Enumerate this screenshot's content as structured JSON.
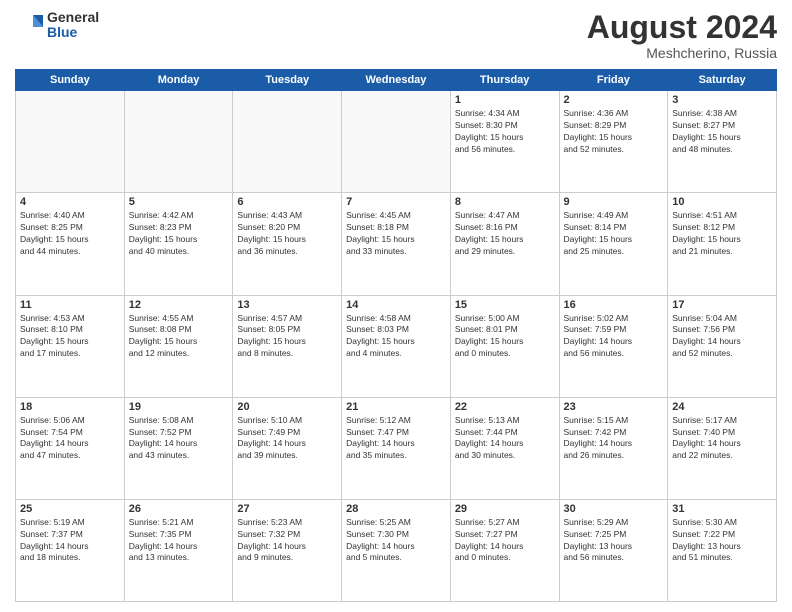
{
  "header": {
    "logo_general": "General",
    "logo_blue": "Blue",
    "month_year": "August 2024",
    "location": "Meshcherino, Russia"
  },
  "days_of_week": [
    "Sunday",
    "Monday",
    "Tuesday",
    "Wednesday",
    "Thursday",
    "Friday",
    "Saturday"
  ],
  "weeks": [
    [
      {
        "day": "",
        "info": ""
      },
      {
        "day": "",
        "info": ""
      },
      {
        "day": "",
        "info": ""
      },
      {
        "day": "",
        "info": ""
      },
      {
        "day": "1",
        "info": "Sunrise: 4:34 AM\nSunset: 8:30 PM\nDaylight: 15 hours\nand 56 minutes."
      },
      {
        "day": "2",
        "info": "Sunrise: 4:36 AM\nSunset: 8:29 PM\nDaylight: 15 hours\nand 52 minutes."
      },
      {
        "day": "3",
        "info": "Sunrise: 4:38 AM\nSunset: 8:27 PM\nDaylight: 15 hours\nand 48 minutes."
      }
    ],
    [
      {
        "day": "4",
        "info": "Sunrise: 4:40 AM\nSunset: 8:25 PM\nDaylight: 15 hours\nand 44 minutes."
      },
      {
        "day": "5",
        "info": "Sunrise: 4:42 AM\nSunset: 8:23 PM\nDaylight: 15 hours\nand 40 minutes."
      },
      {
        "day": "6",
        "info": "Sunrise: 4:43 AM\nSunset: 8:20 PM\nDaylight: 15 hours\nand 36 minutes."
      },
      {
        "day": "7",
        "info": "Sunrise: 4:45 AM\nSunset: 8:18 PM\nDaylight: 15 hours\nand 33 minutes."
      },
      {
        "day": "8",
        "info": "Sunrise: 4:47 AM\nSunset: 8:16 PM\nDaylight: 15 hours\nand 29 minutes."
      },
      {
        "day": "9",
        "info": "Sunrise: 4:49 AM\nSunset: 8:14 PM\nDaylight: 15 hours\nand 25 minutes."
      },
      {
        "day": "10",
        "info": "Sunrise: 4:51 AM\nSunset: 8:12 PM\nDaylight: 15 hours\nand 21 minutes."
      }
    ],
    [
      {
        "day": "11",
        "info": "Sunrise: 4:53 AM\nSunset: 8:10 PM\nDaylight: 15 hours\nand 17 minutes."
      },
      {
        "day": "12",
        "info": "Sunrise: 4:55 AM\nSunset: 8:08 PM\nDaylight: 15 hours\nand 12 minutes."
      },
      {
        "day": "13",
        "info": "Sunrise: 4:57 AM\nSunset: 8:05 PM\nDaylight: 15 hours\nand 8 minutes."
      },
      {
        "day": "14",
        "info": "Sunrise: 4:58 AM\nSunset: 8:03 PM\nDaylight: 15 hours\nand 4 minutes."
      },
      {
        "day": "15",
        "info": "Sunrise: 5:00 AM\nSunset: 8:01 PM\nDaylight: 15 hours\nand 0 minutes."
      },
      {
        "day": "16",
        "info": "Sunrise: 5:02 AM\nSunset: 7:59 PM\nDaylight: 14 hours\nand 56 minutes."
      },
      {
        "day": "17",
        "info": "Sunrise: 5:04 AM\nSunset: 7:56 PM\nDaylight: 14 hours\nand 52 minutes."
      }
    ],
    [
      {
        "day": "18",
        "info": "Sunrise: 5:06 AM\nSunset: 7:54 PM\nDaylight: 14 hours\nand 47 minutes."
      },
      {
        "day": "19",
        "info": "Sunrise: 5:08 AM\nSunset: 7:52 PM\nDaylight: 14 hours\nand 43 minutes."
      },
      {
        "day": "20",
        "info": "Sunrise: 5:10 AM\nSunset: 7:49 PM\nDaylight: 14 hours\nand 39 minutes."
      },
      {
        "day": "21",
        "info": "Sunrise: 5:12 AM\nSunset: 7:47 PM\nDaylight: 14 hours\nand 35 minutes."
      },
      {
        "day": "22",
        "info": "Sunrise: 5:13 AM\nSunset: 7:44 PM\nDaylight: 14 hours\nand 30 minutes."
      },
      {
        "day": "23",
        "info": "Sunrise: 5:15 AM\nSunset: 7:42 PM\nDaylight: 14 hours\nand 26 minutes."
      },
      {
        "day": "24",
        "info": "Sunrise: 5:17 AM\nSunset: 7:40 PM\nDaylight: 14 hours\nand 22 minutes."
      }
    ],
    [
      {
        "day": "25",
        "info": "Sunrise: 5:19 AM\nSunset: 7:37 PM\nDaylight: 14 hours\nand 18 minutes."
      },
      {
        "day": "26",
        "info": "Sunrise: 5:21 AM\nSunset: 7:35 PM\nDaylight: 14 hours\nand 13 minutes."
      },
      {
        "day": "27",
        "info": "Sunrise: 5:23 AM\nSunset: 7:32 PM\nDaylight: 14 hours\nand 9 minutes."
      },
      {
        "day": "28",
        "info": "Sunrise: 5:25 AM\nSunset: 7:30 PM\nDaylight: 14 hours\nand 5 minutes."
      },
      {
        "day": "29",
        "info": "Sunrise: 5:27 AM\nSunset: 7:27 PM\nDaylight: 14 hours\nand 0 minutes."
      },
      {
        "day": "30",
        "info": "Sunrise: 5:29 AM\nSunset: 7:25 PM\nDaylight: 13 hours\nand 56 minutes."
      },
      {
        "day": "31",
        "info": "Sunrise: 5:30 AM\nSunset: 7:22 PM\nDaylight: 13 hours\nand 51 minutes."
      }
    ]
  ]
}
